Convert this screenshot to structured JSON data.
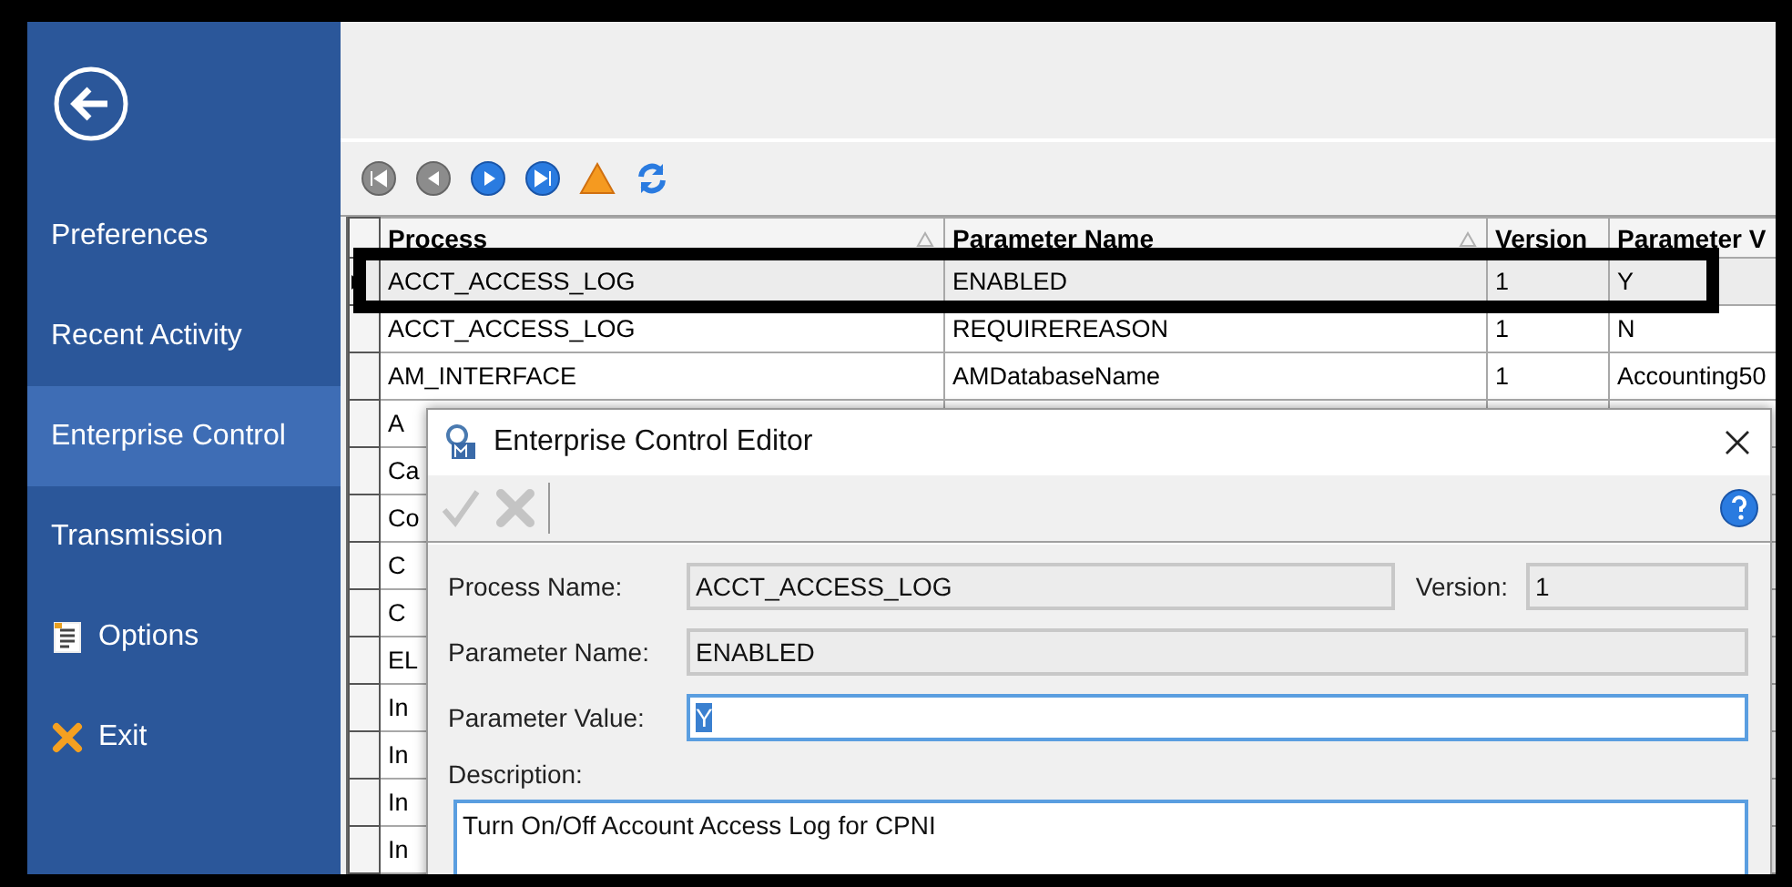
{
  "sidebar": {
    "items": [
      {
        "label": "Preferences",
        "kind": "plain",
        "selected": false
      },
      {
        "label": "Recent Activity",
        "kind": "plain",
        "selected": false
      },
      {
        "label": "Enterprise Control",
        "kind": "plain",
        "selected": true
      },
      {
        "label": "Transmission",
        "kind": "plain",
        "selected": false
      },
      {
        "label": "Options",
        "kind": "document",
        "selected": false
      },
      {
        "label": "Exit",
        "kind": "exit",
        "selected": false
      }
    ]
  },
  "toolbar": [
    {
      "kind": "first",
      "disabled": true
    },
    {
      "kind": "previous",
      "disabled": true
    },
    {
      "kind": "next",
      "disabled": false
    },
    {
      "kind": "last",
      "disabled": false
    },
    {
      "kind": "warning",
      "disabled": false
    },
    {
      "kind": "refresh",
      "disabled": false
    }
  ],
  "table": {
    "columns": [
      {
        "label": "Process",
        "sorted": true
      },
      {
        "label": "Parameter Name",
        "sorted": true
      },
      {
        "label": "Version",
        "sorted": false
      },
      {
        "label": "Parameter V",
        "sorted": false
      }
    ],
    "rows": [
      {
        "cells": [
          "ACCT_ACCESS_LOG",
          "ENABLED",
          "1",
          "Y"
        ],
        "selected": true,
        "outlined": true
      },
      {
        "cells": [
          "ACCT_ACCESS_LOG",
          "REQUIREREASON",
          "1",
          "N"
        ],
        "selected": false,
        "outlined": false
      },
      {
        "cells": [
          "AM_INTERFACE",
          "AMDatabaseName",
          "1",
          "Accounting50"
        ],
        "selected": false,
        "outlined": false
      },
      {
        "cells": [
          "A"
        ],
        "selected": false,
        "outlined": false
      },
      {
        "cells": [
          "Ca"
        ],
        "selected": false,
        "outlined": false
      },
      {
        "cells": [
          "Co"
        ],
        "selected": false,
        "outlined": false
      },
      {
        "cells": [
          "C"
        ],
        "selected": false,
        "outlined": false
      },
      {
        "cells": [
          "C"
        ],
        "selected": false,
        "outlined": false
      },
      {
        "cells": [
          "EL"
        ],
        "selected": false,
        "outlined": false
      },
      {
        "cells": [
          "In"
        ],
        "selected": false,
        "outlined": false
      },
      {
        "cells": [
          "In"
        ],
        "selected": false,
        "outlined": false
      },
      {
        "cells": [
          "In"
        ],
        "selected": false,
        "outlined": false
      },
      {
        "cells": [
          "In"
        ],
        "selected": false,
        "outlined": false
      }
    ]
  },
  "dialog": {
    "title": "Enterprise Control Editor",
    "toolbar": [
      {
        "kind": "accept",
        "disabled": true
      },
      {
        "kind": "cancel",
        "disabled": true
      }
    ],
    "process_name": {
      "label": "Process Name:",
      "value": "ACCT_ACCESS_LOG"
    },
    "version": {
      "label": "Version:",
      "value": "1"
    },
    "parameter_name": {
      "label": "Parameter Name:",
      "value": "ENABLED"
    },
    "parameter_value": {
      "label": "Parameter Value:",
      "value": "Y"
    },
    "description": {
      "label": "Description:",
      "value": "Turn On/Off Account Access Log for CPNI"
    }
  }
}
